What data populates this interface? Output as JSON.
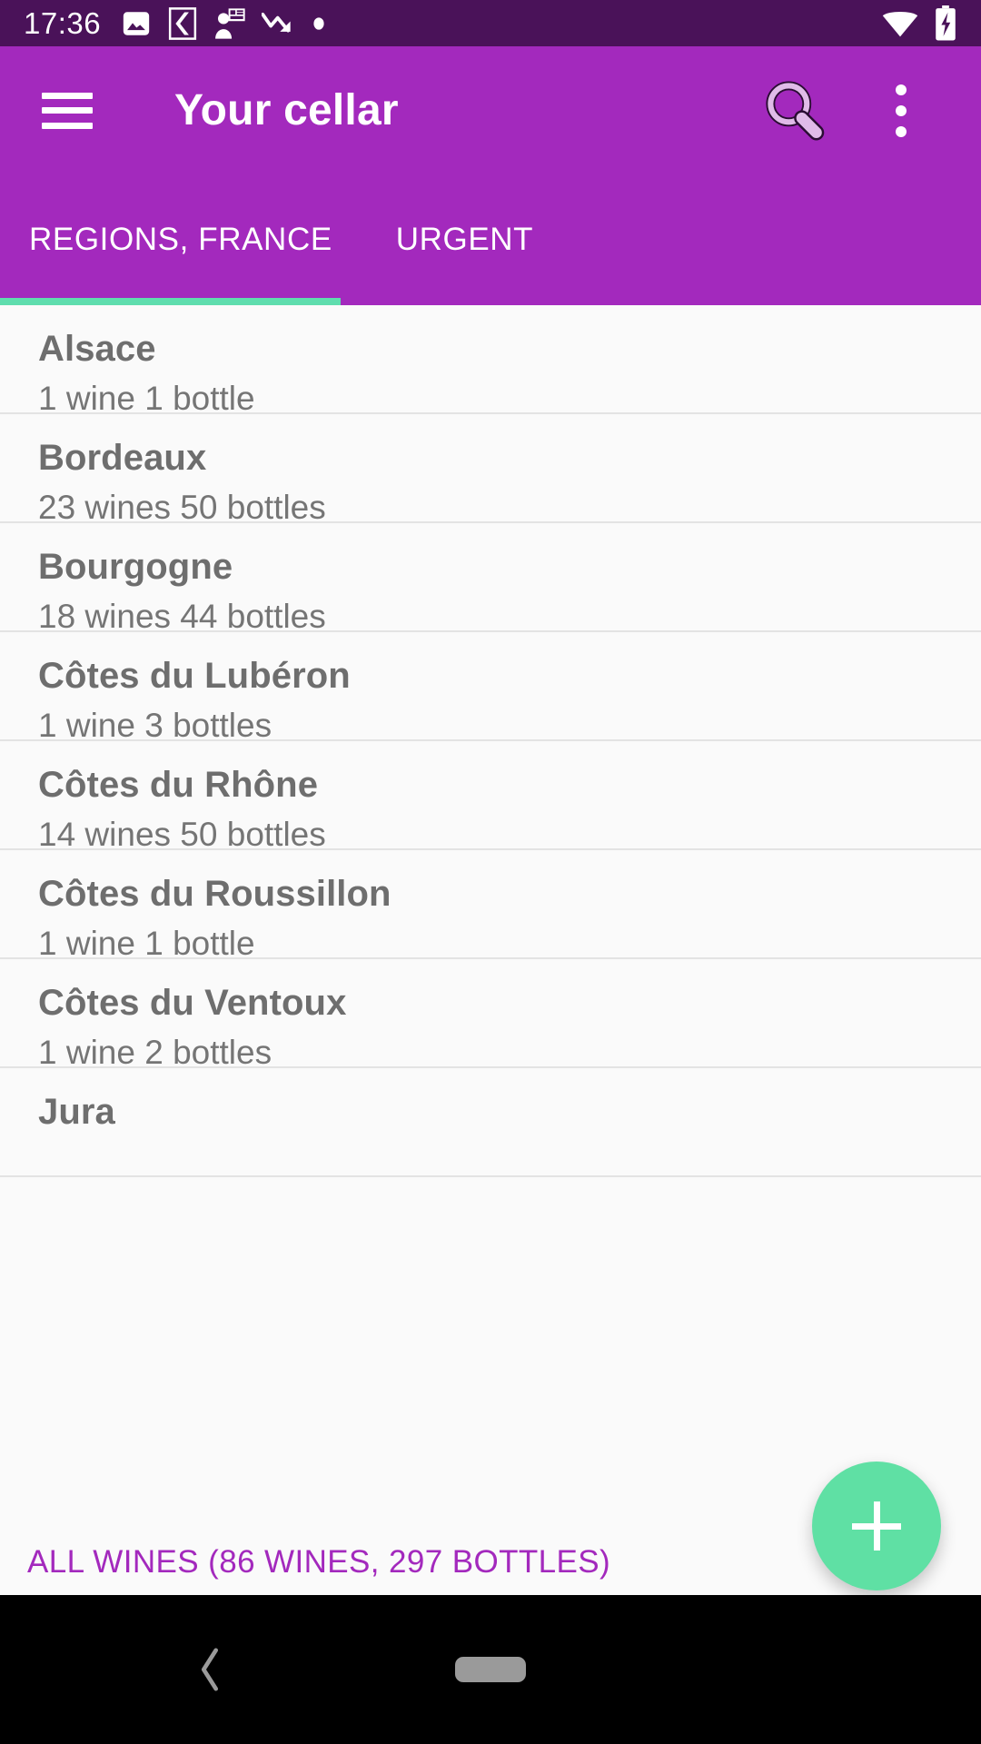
{
  "statusbar": {
    "clock": "17:36",
    "left_icons": [
      "image-icon",
      "bracket-icon",
      "person-presentation-icon",
      "trending-down-icon",
      "dot-icon"
    ],
    "right_icons": [
      "wifi-icon",
      "battery-charging-icon"
    ]
  },
  "appbar": {
    "menu_icon": "hamburger-menu-icon",
    "title": "Your cellar",
    "search_icon": "search-icon",
    "overflow_icon": "more-vert-icon"
  },
  "tabs": {
    "items": [
      {
        "label": "REGIONS, FRANCE",
        "selected": true
      },
      {
        "label": "URGENT",
        "selected": false
      }
    ],
    "indicator_color": "#5fddae"
  },
  "list": {
    "items": [
      {
        "title": "Alsace",
        "subtitle": "1 wine 1 bottle"
      },
      {
        "title": "Bordeaux",
        "subtitle": "23 wines 50 bottles"
      },
      {
        "title": "Bourgogne",
        "subtitle": "18 wines 44 bottles"
      },
      {
        "title": "Côtes du Lubéron",
        "subtitle": "1 wine 3 bottles"
      },
      {
        "title": "Côtes du Rhône",
        "subtitle": "14 wines 50 bottles"
      },
      {
        "title": "Côtes du Roussillon",
        "subtitle": "1 wine 1 bottle"
      },
      {
        "title": "Côtes du Ventoux",
        "subtitle": "1 wine 2 bottles"
      },
      {
        "title": "Jura",
        "subtitle": ""
      }
    ]
  },
  "bottom": {
    "all_wines_label": "ALL WINES (86 WINES, 297 BOTTLES)"
  },
  "fab": {
    "icon": "plus-icon",
    "color": "#5fe0a4"
  },
  "navbar": {
    "back_icon": "back-chevron-icon",
    "home_icon": "home-pill-icon"
  },
  "colors": {
    "statusbar": "#4a1259",
    "primary": "#a329bd",
    "accent": "#5fddae",
    "background": "#fafafa"
  }
}
